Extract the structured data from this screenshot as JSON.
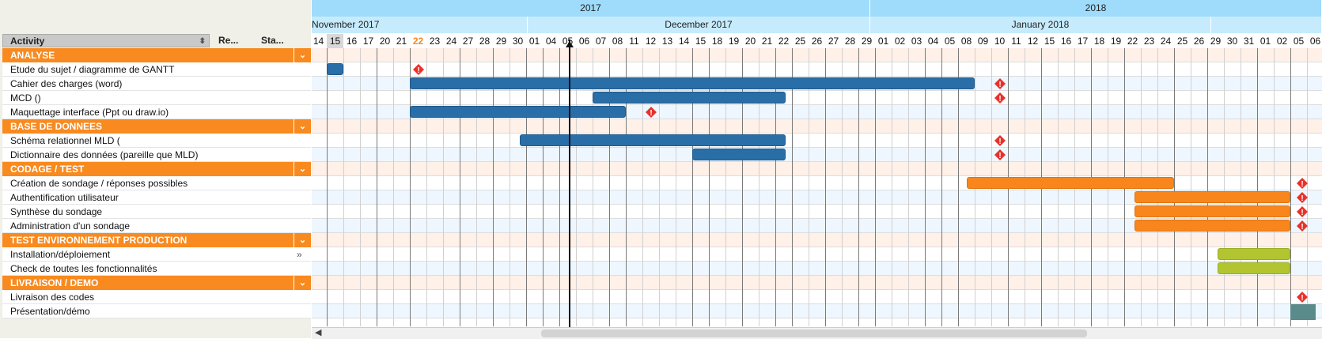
{
  "left_header": {
    "activity": "Activity",
    "re": "Re...",
    "sta": "Sta..."
  },
  "rows": [
    {
      "type": "group",
      "label": "ANALYSE"
    },
    {
      "type": "task",
      "label": "Etude du sujet / diagramme de GANTT"
    },
    {
      "type": "task",
      "label": "Cahier des charges (word)"
    },
    {
      "type": "task",
      "label": "MCD ()"
    },
    {
      "type": "task",
      "label": "Maquettage interface (Ppt ou draw.io)"
    },
    {
      "type": "group",
      "label": "BASE DE DONNEES"
    },
    {
      "type": "task",
      "label": "Schéma relationnel MLD ("
    },
    {
      "type": "task",
      "label": "Dictionnaire des données (pareille que MLD)"
    },
    {
      "type": "group",
      "label": "CODAGE / TEST"
    },
    {
      "type": "task",
      "label": "Création de sondage / réponses possibles"
    },
    {
      "type": "task",
      "label": "Authentification utilisateur"
    },
    {
      "type": "task",
      "label": "Synthèse du sondage"
    },
    {
      "type": "task",
      "label": "Administration d'un sondage"
    },
    {
      "type": "group",
      "label": "TEST ENVIRONNEMENT PRODUCTION"
    },
    {
      "type": "task",
      "label": "Installation/déploiement",
      "expand": "»"
    },
    {
      "type": "task",
      "label": "Check de toutes les fonctionnalités"
    },
    {
      "type": "group",
      "label": "LIVRAISON / DEMO"
    },
    {
      "type": "task",
      "label": "Livraison des codes"
    },
    {
      "type": "task",
      "label": "Présentation/démo"
    }
  ],
  "timeline": {
    "years": [
      "2017",
      "2018"
    ],
    "months": [
      "November 2017",
      "December 2017",
      "January 2018"
    ],
    "days": [
      "14",
      "15",
      "16",
      "17",
      "20",
      "21",
      "22",
      "23",
      "24",
      "27",
      "28",
      "29",
      "30",
      "01",
      "04",
      "05",
      "06",
      "07",
      "08",
      "11",
      "12",
      "13",
      "14",
      "15",
      "18",
      "19",
      "20",
      "21",
      "22",
      "25",
      "26",
      "27",
      "28",
      "29",
      "01",
      "02",
      "03",
      "04",
      "05",
      "08",
      "09",
      "10",
      "11",
      "12",
      "15",
      "16",
      "17",
      "18",
      "19",
      "22",
      "23",
      "24",
      "25",
      "26",
      "29",
      "30",
      "31",
      "01",
      "02",
      "05",
      "06"
    ],
    "today_index": 1,
    "highlight_index": 6
  },
  "colors": {
    "group_orange": "#f88a1f",
    "bar_blue": "#2a6ea8",
    "bar_orange": "#f8861c",
    "bar_lime": "#b2c430",
    "header_blue": "#9fdcfb",
    "month_blue": "#c6ebfd",
    "warn_red": "#e8312a"
  },
  "icons": {
    "nav_left": "chevron-left-icon",
    "nav_right": "chevron-right-icon",
    "group_toggle": "chevron-down-icon",
    "sort": "sort-icon",
    "warning": "warning-diamond-icon"
  }
}
